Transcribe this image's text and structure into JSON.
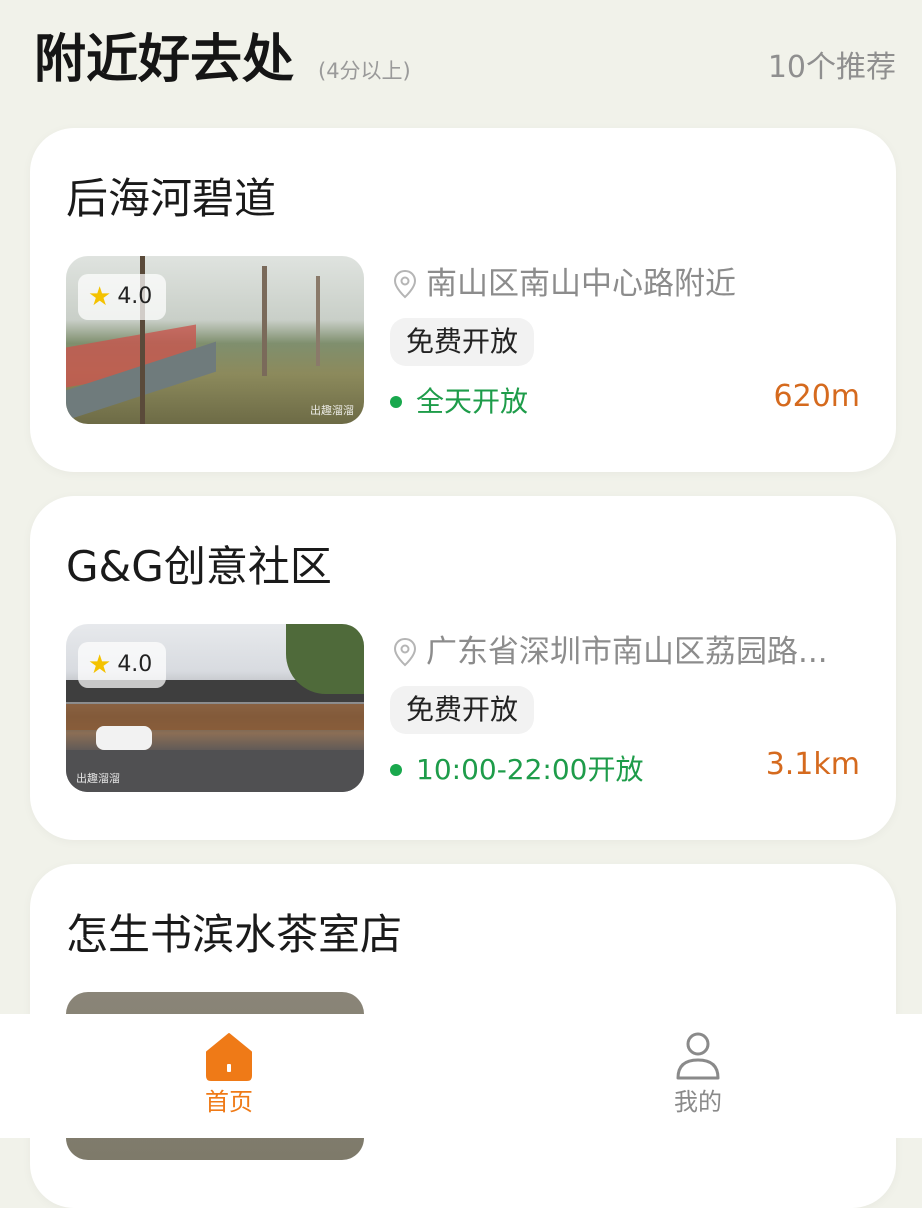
{
  "header": {
    "title": "附近好去处",
    "subtitle": "(4分以上)",
    "count": "10个推荐"
  },
  "places": [
    {
      "name": "后海河碧道",
      "rating": "4.0",
      "address": "南山区南山中心路附近",
      "tag": "免费开放",
      "hours": "全天开放",
      "distance": "620m",
      "watermark": "出趣溜溜"
    },
    {
      "name": "G&G创意社区",
      "rating": "4.0",
      "address": "广东省深圳市南山区荔园路...",
      "tag": "免费开放",
      "hours": "10:00-22:00开放",
      "distance": "3.1km",
      "watermark": "出趣溜溜"
    },
    {
      "name": "怎生书滨水茶室店",
      "rating": "",
      "address": "",
      "tag": "",
      "hours": "",
      "distance": ""
    }
  ],
  "nav": {
    "home_label": "首页",
    "mine_label": "我的"
  },
  "colors": {
    "background": "#f1f2ea",
    "accent": "#ef7a17",
    "distance": "#d56a1e",
    "open_green": "#1e9c4a",
    "star": "#f4c200"
  },
  "icons": {
    "location": "location-pin-icon",
    "star": "star-icon",
    "home": "home-icon",
    "profile": "profile-icon"
  }
}
